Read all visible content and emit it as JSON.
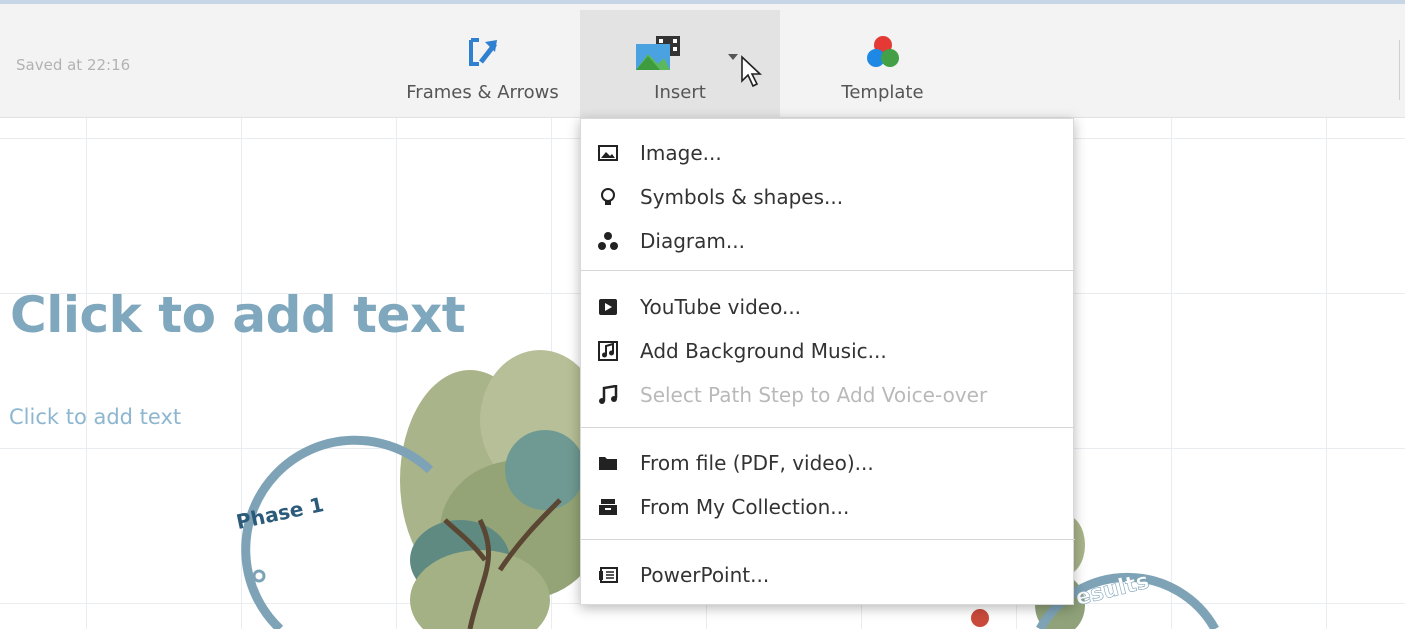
{
  "toolbar": {
    "saved_status": "Saved at 22:16",
    "frames_label": "Frames & Arrows",
    "insert_label": "Insert",
    "template_label": "Template"
  },
  "slide": {
    "title_placeholder": "Click to add text",
    "body_placeholder": "Click to add text",
    "phase_label": "Phase 1",
    "results_label": "esults"
  },
  "insert_menu": {
    "groups": [
      [
        {
          "label": "Image...",
          "icon": "image-icon"
        },
        {
          "label": "Symbols & shapes...",
          "icon": "lightbulb-icon"
        },
        {
          "label": "Diagram...",
          "icon": "diagram-icon"
        }
      ],
      [
        {
          "label": "YouTube video...",
          "icon": "youtube-icon"
        },
        {
          "label": "Add Background Music...",
          "icon": "music-file-icon"
        },
        {
          "label": "Select Path Step to Add Voice-over",
          "icon": "music-note-icon",
          "disabled": true
        }
      ],
      [
        {
          "label": "From file (PDF, video)...",
          "icon": "folder-icon"
        },
        {
          "label": "From My Collection...",
          "icon": "collection-icon"
        }
      ],
      [
        {
          "label": "PowerPoint...",
          "icon": "powerpoint-icon"
        }
      ]
    ]
  },
  "colors": {
    "title_text": "#7fa7bd",
    "body_text": "#8db6d0",
    "toolbar_bg": "#f3f3f3",
    "insert_active_bg": "#e3e3e3",
    "disabled_text": "#b9b9b9"
  }
}
